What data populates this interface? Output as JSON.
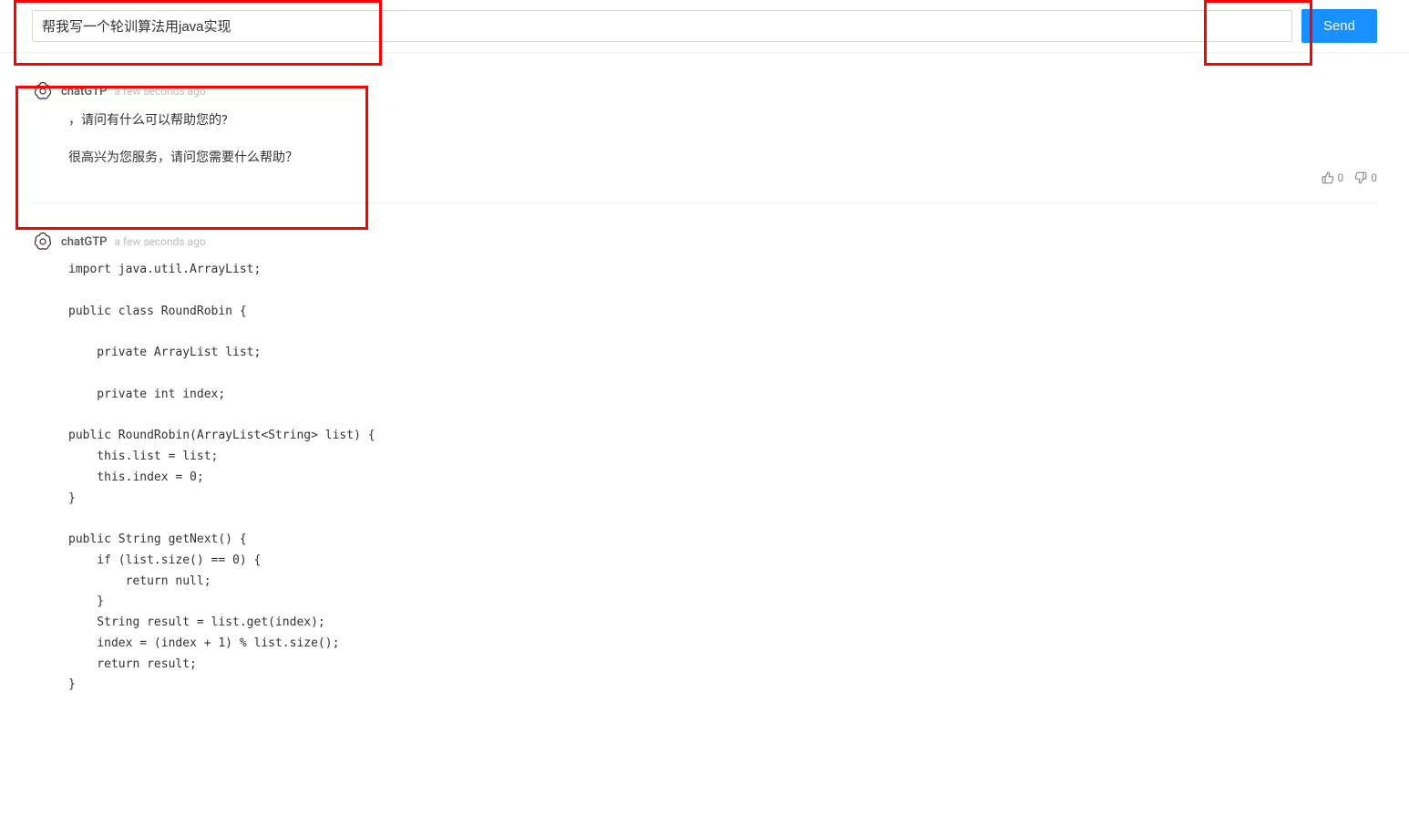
{
  "input": {
    "value": "帮我写一个轮训算法用java实现",
    "send_label": "Send"
  },
  "messages": [
    {
      "author": "chatGTP",
      "timestamp": "a few seconds ago",
      "paragraphs": [
        "，请问有什么可以帮助您的?",
        "很高兴为您服务，请问您需要什么帮助？"
      ],
      "likes": "0",
      "dislikes": "0"
    },
    {
      "author": "chatGTP",
      "timestamp": "a few seconds ago",
      "code": "import java.util.ArrayList;\n\npublic class RoundRobin {\n\n    private ArrayList list;\n\n    private int index;\n\npublic RoundRobin(ArrayList<String> list) {\n    this.list = list;\n    this.index = 0;\n}\n\npublic String getNext() {\n    if (list.size() == 0) {\n        return null;\n    }\n    String result = list.get(index);\n    index = (index + 1) % list.size();\n    return result;\n}"
    }
  ]
}
